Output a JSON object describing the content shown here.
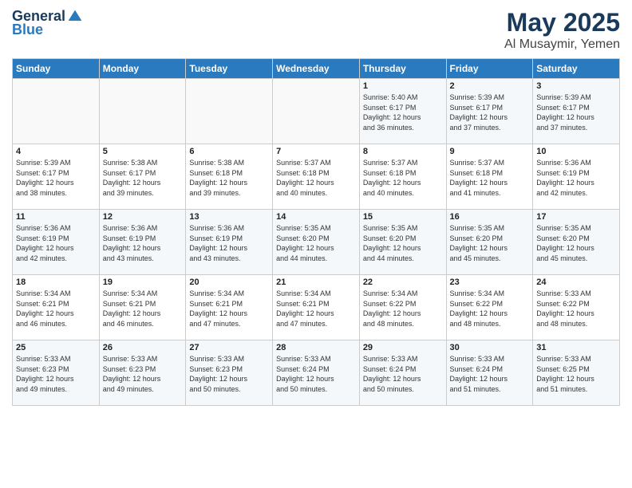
{
  "header": {
    "logo_general": "General",
    "logo_blue": "Blue",
    "title": "May 2025",
    "subtitle": "Al Musaymir, Yemen"
  },
  "weekdays": [
    "Sunday",
    "Monday",
    "Tuesday",
    "Wednesday",
    "Thursday",
    "Friday",
    "Saturday"
  ],
  "weeks": [
    [
      {
        "day": "",
        "info": ""
      },
      {
        "day": "",
        "info": ""
      },
      {
        "day": "",
        "info": ""
      },
      {
        "day": "",
        "info": ""
      },
      {
        "day": "1",
        "info": "Sunrise: 5:40 AM\nSunset: 6:17 PM\nDaylight: 12 hours\nand 36 minutes."
      },
      {
        "day": "2",
        "info": "Sunrise: 5:39 AM\nSunset: 6:17 PM\nDaylight: 12 hours\nand 37 minutes."
      },
      {
        "day": "3",
        "info": "Sunrise: 5:39 AM\nSunset: 6:17 PM\nDaylight: 12 hours\nand 37 minutes."
      }
    ],
    [
      {
        "day": "4",
        "info": "Sunrise: 5:39 AM\nSunset: 6:17 PM\nDaylight: 12 hours\nand 38 minutes."
      },
      {
        "day": "5",
        "info": "Sunrise: 5:38 AM\nSunset: 6:17 PM\nDaylight: 12 hours\nand 39 minutes."
      },
      {
        "day": "6",
        "info": "Sunrise: 5:38 AM\nSunset: 6:18 PM\nDaylight: 12 hours\nand 39 minutes."
      },
      {
        "day": "7",
        "info": "Sunrise: 5:37 AM\nSunset: 6:18 PM\nDaylight: 12 hours\nand 40 minutes."
      },
      {
        "day": "8",
        "info": "Sunrise: 5:37 AM\nSunset: 6:18 PM\nDaylight: 12 hours\nand 40 minutes."
      },
      {
        "day": "9",
        "info": "Sunrise: 5:37 AM\nSunset: 6:18 PM\nDaylight: 12 hours\nand 41 minutes."
      },
      {
        "day": "10",
        "info": "Sunrise: 5:36 AM\nSunset: 6:19 PM\nDaylight: 12 hours\nand 42 minutes."
      }
    ],
    [
      {
        "day": "11",
        "info": "Sunrise: 5:36 AM\nSunset: 6:19 PM\nDaylight: 12 hours\nand 42 minutes."
      },
      {
        "day": "12",
        "info": "Sunrise: 5:36 AM\nSunset: 6:19 PM\nDaylight: 12 hours\nand 43 minutes."
      },
      {
        "day": "13",
        "info": "Sunrise: 5:36 AM\nSunset: 6:19 PM\nDaylight: 12 hours\nand 43 minutes."
      },
      {
        "day": "14",
        "info": "Sunrise: 5:35 AM\nSunset: 6:20 PM\nDaylight: 12 hours\nand 44 minutes."
      },
      {
        "day": "15",
        "info": "Sunrise: 5:35 AM\nSunset: 6:20 PM\nDaylight: 12 hours\nand 44 minutes."
      },
      {
        "day": "16",
        "info": "Sunrise: 5:35 AM\nSunset: 6:20 PM\nDaylight: 12 hours\nand 45 minutes."
      },
      {
        "day": "17",
        "info": "Sunrise: 5:35 AM\nSunset: 6:20 PM\nDaylight: 12 hours\nand 45 minutes."
      }
    ],
    [
      {
        "day": "18",
        "info": "Sunrise: 5:34 AM\nSunset: 6:21 PM\nDaylight: 12 hours\nand 46 minutes."
      },
      {
        "day": "19",
        "info": "Sunrise: 5:34 AM\nSunset: 6:21 PM\nDaylight: 12 hours\nand 46 minutes."
      },
      {
        "day": "20",
        "info": "Sunrise: 5:34 AM\nSunset: 6:21 PM\nDaylight: 12 hours\nand 47 minutes."
      },
      {
        "day": "21",
        "info": "Sunrise: 5:34 AM\nSunset: 6:21 PM\nDaylight: 12 hours\nand 47 minutes."
      },
      {
        "day": "22",
        "info": "Sunrise: 5:34 AM\nSunset: 6:22 PM\nDaylight: 12 hours\nand 48 minutes."
      },
      {
        "day": "23",
        "info": "Sunrise: 5:34 AM\nSunset: 6:22 PM\nDaylight: 12 hours\nand 48 minutes."
      },
      {
        "day": "24",
        "info": "Sunrise: 5:33 AM\nSunset: 6:22 PM\nDaylight: 12 hours\nand 48 minutes."
      }
    ],
    [
      {
        "day": "25",
        "info": "Sunrise: 5:33 AM\nSunset: 6:23 PM\nDaylight: 12 hours\nand 49 minutes."
      },
      {
        "day": "26",
        "info": "Sunrise: 5:33 AM\nSunset: 6:23 PM\nDaylight: 12 hours\nand 49 minutes."
      },
      {
        "day": "27",
        "info": "Sunrise: 5:33 AM\nSunset: 6:23 PM\nDaylight: 12 hours\nand 50 minutes."
      },
      {
        "day": "28",
        "info": "Sunrise: 5:33 AM\nSunset: 6:24 PM\nDaylight: 12 hours\nand 50 minutes."
      },
      {
        "day": "29",
        "info": "Sunrise: 5:33 AM\nSunset: 6:24 PM\nDaylight: 12 hours\nand 50 minutes."
      },
      {
        "day": "30",
        "info": "Sunrise: 5:33 AM\nSunset: 6:24 PM\nDaylight: 12 hours\nand 51 minutes."
      },
      {
        "day": "31",
        "info": "Sunrise: 5:33 AM\nSunset: 6:25 PM\nDaylight: 12 hours\nand 51 minutes."
      }
    ]
  ]
}
